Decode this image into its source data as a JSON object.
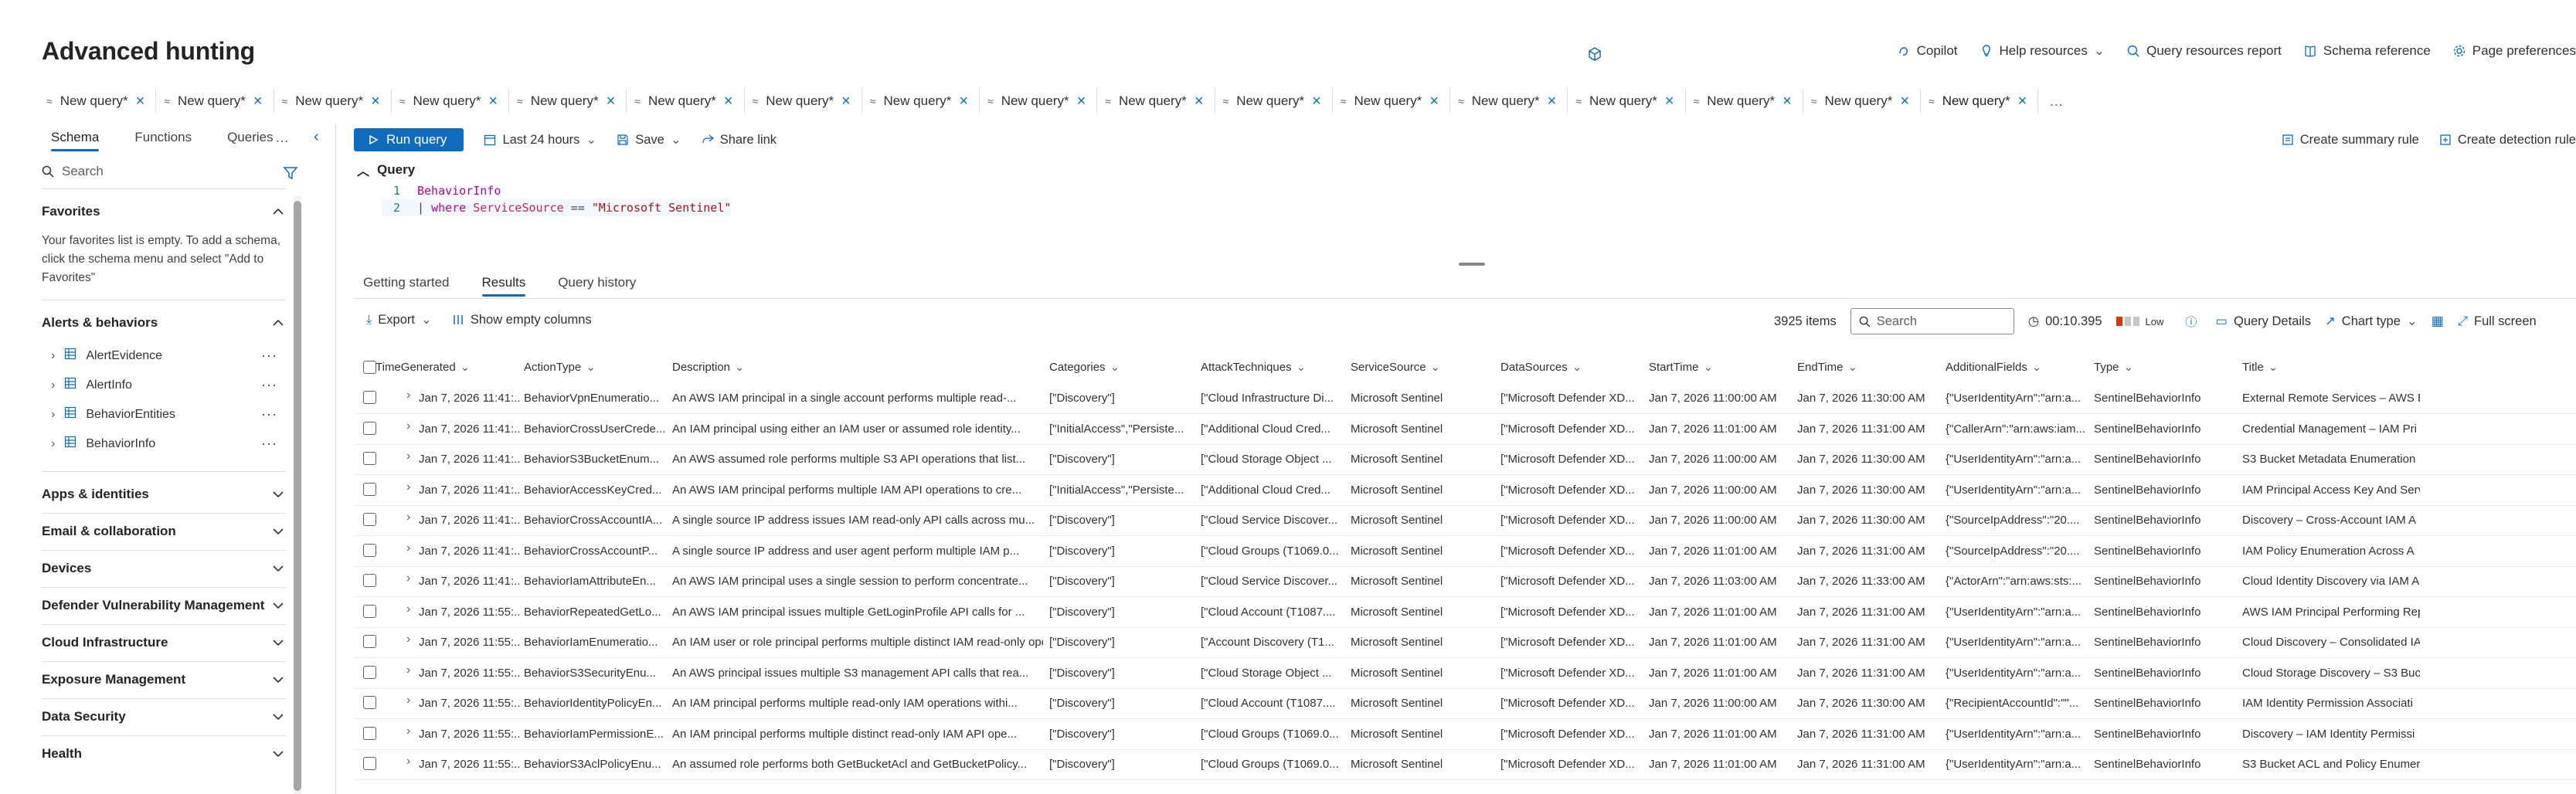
{
  "page": {
    "title": "Advanced hunting",
    "header_actions": [
      {
        "label": "Copilot",
        "icon": "copilot-icon"
      },
      {
        "label": "Help resources",
        "icon": "lightbulb-icon",
        "dropdown": true
      },
      {
        "label": "Query resources report",
        "icon": "report-icon"
      },
      {
        "label": "Schema reference",
        "icon": "book-icon"
      },
      {
        "label": "Page preferences",
        "icon": "gear-icon"
      }
    ]
  },
  "query_tabs": {
    "tabs": [
      "New query*",
      "New query*",
      "New query*",
      "New query*",
      "New query*",
      "New query*",
      "New query*",
      "New query*",
      "New query*",
      "New query*",
      "New query*",
      "New query*",
      "New query*",
      "New query*",
      "New query*",
      "New query*",
      "New query*"
    ],
    "active_index": 16,
    "more": "…"
  },
  "left_pane": {
    "tabs": [
      "Schema",
      "Functions",
      "Queries"
    ],
    "more": "…",
    "search_placeholder": "Search",
    "favorites": {
      "title": "Favorites",
      "empty_text": "Your favorites list is empty. To add a schema, click the schema menu and select \"Add to Favorites\""
    },
    "alerts": {
      "title": "Alerts & behaviors",
      "tables": [
        "AlertEvidence",
        "AlertInfo",
        "BehaviorEntities",
        "BehaviorInfo"
      ]
    },
    "sections": [
      "Apps & identities",
      "Email & collaboration",
      "Devices",
      "Defender Vulnerability Management",
      "Cloud Infrastructure",
      "Exposure Management",
      "Data Security",
      "Health"
    ]
  },
  "toolbar": {
    "run": "Run query",
    "time_range": "Last 24 hours",
    "save": "Save",
    "share": "Share link",
    "create_summary": "Create summary rule",
    "create_detection": "Create detection rule"
  },
  "query_editor": {
    "heading": "Query",
    "line1_num": "1",
    "line2_num": "2",
    "line1": "BehaviorInfo",
    "line2_pipe": "| ",
    "line2_where": "where ",
    "line2_field": "ServiceSource",
    "line2_op": " == ",
    "line2_value": "\"Microsoft Sentinel\""
  },
  "results": {
    "tabs": [
      "Getting started",
      "Results",
      "Query history"
    ],
    "active_tab": 1,
    "export": "Export",
    "show_empty": "Show empty columns",
    "count": "3925 items",
    "search_placeholder": "Search",
    "duration": "00:10.395",
    "level": "Low",
    "query_details": "Query Details",
    "chart_type": "Chart type",
    "full_screen": "Full screen",
    "columns": [
      "TimeGenerated",
      "ActionType",
      "Description",
      "Categories",
      "AttackTechniques",
      "ServiceSource",
      "DataSources",
      "StartTime",
      "EndTime",
      "AdditionalFields",
      "Type",
      "Title"
    ],
    "rows": [
      [
        "Jan 7, 2026 11:41:...",
        "BehaviorVpnEnumeratio...",
        "An AWS IAM principal in a single account performs multiple read-...",
        "[\"Discovery\"]",
        "[\"Cloud Infrastructure Di...",
        "Microsoft Sentinel",
        "[\"Microsoft Defender XD...",
        "Jan 7, 2026 11:00:00 AM",
        "Jan 7, 2026 11:30:00 AM",
        "{\"UserIdentityArn\":\"arn:a...",
        "SentinelBehaviorInfo",
        "External Remote Services – AWS E"
      ],
      [
        "Jan 7, 2026 11:41:...",
        "BehaviorCrossUserCrede...",
        "An IAM principal using either an IAM user or assumed role identity...",
        "[\"InitialAccess\",\"Persiste...",
        "[\"Additional Cloud Cred...",
        "Microsoft Sentinel",
        "[\"Microsoft Defender XD...",
        "Jan 7, 2026 11:01:00 AM",
        "Jan 7, 2026 11:31:00 AM",
        "{\"CallerArn\":\"arn:aws:iam...",
        "SentinelBehaviorInfo",
        "Credential Management – IAM Pri"
      ],
      [
        "Jan 7, 2026 11:41:...",
        "BehaviorS3BucketEnum...",
        "An AWS assumed role performs multiple S3 API operations that list...",
        "[\"Discovery\"]",
        "[\"Cloud Storage Object ...",
        "Microsoft Sentinel",
        "[\"Microsoft Defender XD...",
        "Jan 7, 2026 11:00:00 AM",
        "Jan 7, 2026 11:30:00 AM",
        "{\"UserIdentityArn\":\"arn:a...",
        "SentinelBehaviorInfo",
        "S3 Bucket Metadata Enumeration"
      ],
      [
        "Jan 7, 2026 11:41:...",
        "BehaviorAccessKeyCred...",
        "An AWS IAM principal performs multiple IAM API operations to cre...",
        "[\"InitialAccess\",\"Persiste...",
        "[\"Additional Cloud Cred...",
        "Microsoft Sentinel",
        "[\"Microsoft Defender XD...",
        "Jan 7, 2026 11:00:00 AM",
        "Jan 7, 2026 11:30:00 AM",
        "{\"UserIdentityArn\":\"arn:a...",
        "SentinelBehaviorInfo",
        "IAM Principal Access Key And Serv"
      ],
      [
        "Jan 7, 2026 11:41:...",
        "BehaviorCrossAccountIA...",
        "A single source IP address issues IAM read-only API calls across mu...",
        "[\"Discovery\"]",
        "[\"Cloud Service Discover...",
        "Microsoft Sentinel",
        "[\"Microsoft Defender XD...",
        "Jan 7, 2026 11:00:00 AM",
        "Jan 7, 2026 11:30:00 AM",
        "{\"SourceIpAddress\":\"20....",
        "SentinelBehaviorInfo",
        "Discovery – Cross-Account IAM A"
      ],
      [
        "Jan 7, 2026 11:41:...",
        "BehaviorCrossAccountP...",
        "A single source IP address and user agent perform multiple IAM p...",
        "[\"Discovery\"]",
        "[\"Cloud Groups (T1069.0...",
        "Microsoft Sentinel",
        "[\"Microsoft Defender XD...",
        "Jan 7, 2026 11:01:00 AM",
        "Jan 7, 2026 11:31:00 AM",
        "{\"SourceIpAddress\":\"20....",
        "SentinelBehaviorInfo",
        "IAM Policy Enumeration Across A"
      ],
      [
        "Jan 7, 2026 11:41:...",
        "BehaviorIamAttributeEn...",
        "An AWS IAM principal uses a single session to perform concentrate...",
        "[\"Discovery\"]",
        "[\"Cloud Service Discover...",
        "Microsoft Sentinel",
        "[\"Microsoft Defender XD...",
        "Jan 7, 2026 11:03:00 AM",
        "Jan 7, 2026 11:33:00 AM",
        "{\"ActorArn\":\"arn:aws:sts:...",
        "SentinelBehaviorInfo",
        "Cloud Identity Discovery via IAM A"
      ],
      [
        "Jan 7, 2026 11:55:...",
        "BehaviorRepeatedGetLo...",
        "An AWS IAM principal issues multiple GetLoginProfile API calls for ...",
        "[\"Discovery\"]",
        "[\"Cloud Account (T1087....",
        "Microsoft Sentinel",
        "[\"Microsoft Defender XD...",
        "Jan 7, 2026 11:01:00 AM",
        "Jan 7, 2026 11:31:00 AM",
        "{\"UserIdentityArn\":\"arn:a...",
        "SentinelBehaviorInfo",
        "AWS IAM Principal Performing Rep"
      ],
      [
        "Jan 7, 2026 11:55:...",
        "BehaviorIamEnumeratio...",
        "An IAM user or role principal performs multiple distinct IAM read-only oper...",
        "[\"Discovery\"]",
        "[\"Account Discovery (T1...",
        "Microsoft Sentinel",
        "[\"Microsoft Defender XD...",
        "Jan 7, 2026 11:01:00 AM",
        "Jan 7, 2026 11:31:00 AM",
        "{\"UserIdentityArn\":\"arn:a...",
        "SentinelBehaviorInfo",
        "Cloud Discovery – Consolidated IA"
      ],
      [
        "Jan 7, 2026 11:55:...",
        "BehaviorS3SecurityEnu...",
        "An AWS principal issues multiple S3 management API calls that rea...",
        "[\"Discovery\"]",
        "[\"Cloud Storage Object ...",
        "Microsoft Sentinel",
        "[\"Microsoft Defender XD...",
        "Jan 7, 2026 11:01:00 AM",
        "Jan 7, 2026 11:31:00 AM",
        "{\"UserIdentityArn\":\"arn:a...",
        "SentinelBehaviorInfo",
        "Cloud Storage Discovery – S3 Buc"
      ],
      [
        "Jan 7, 2026 11:55:...",
        "BehaviorIdentityPolicyEn...",
        "An IAM principal performs multiple read-only IAM operations withi...",
        "[\"Discovery\"]",
        "[\"Cloud Account (T1087....",
        "Microsoft Sentinel",
        "[\"Microsoft Defender XD...",
        "Jan 7, 2026 11:00:00 AM",
        "Jan 7, 2026 11:30:00 AM",
        "{\"RecipientAccountId\":\"\"...",
        "SentinelBehaviorInfo",
        "IAM Identity Permission Associati"
      ],
      [
        "Jan 7, 2026 11:55:...",
        "BehaviorIamPermissionE...",
        "An IAM principal performs multiple distinct read-only IAM API ope...",
        "[\"Discovery\"]",
        "[\"Cloud Groups (T1069.0...",
        "Microsoft Sentinel",
        "[\"Microsoft Defender XD...",
        "Jan 7, 2026 11:01:00 AM",
        "Jan 7, 2026 11:31:00 AM",
        "{\"UserIdentityArn\":\"arn:a...",
        "SentinelBehaviorInfo",
        "Discovery – IAM Identity Permissi"
      ],
      [
        "Jan 7, 2026 11:55:...",
        "BehaviorS3AclPolicyEnu...",
        "An assumed role performs both GetBucketAcl and GetBucketPolicy...",
        "[\"Discovery\"]",
        "[\"Cloud Groups (T1069.0...",
        "Microsoft Sentinel",
        "[\"Microsoft Defender XD...",
        "Jan 7, 2026 11:01:00 AM",
        "Jan 7, 2026 11:31:00 AM",
        "{\"UserIdentityArn\":\"arn:a...",
        "SentinelBehaviorInfo",
        "S3 Bucket ACL and Policy Enumera"
      ]
    ]
  },
  "colors": {
    "accent": "#0f6cbd",
    "level_low": "#d83b01",
    "level_off": "#c8c6c4"
  }
}
